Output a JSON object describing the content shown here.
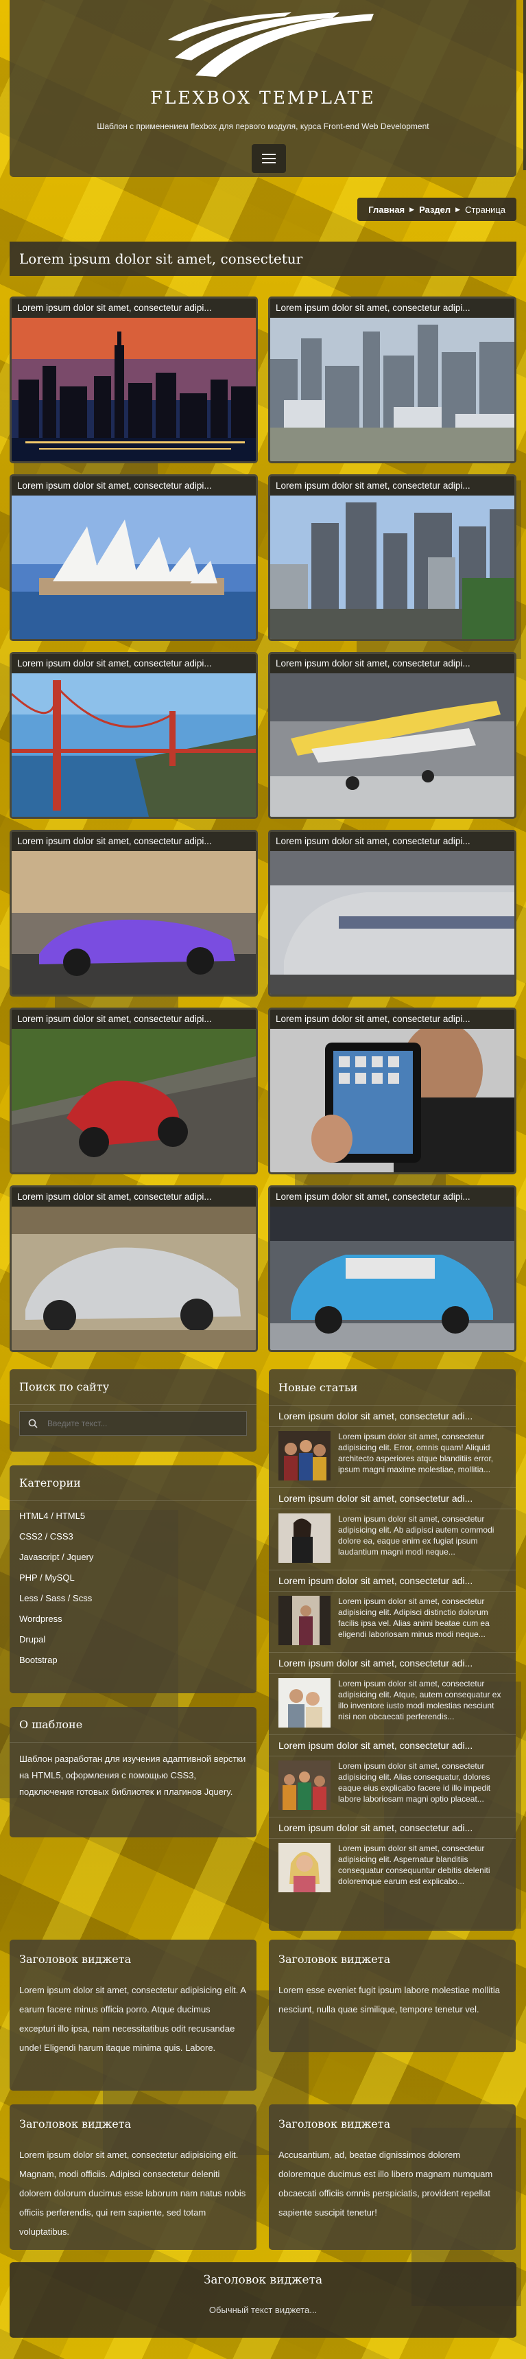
{
  "header": {
    "title": "FLEXBOX TEMPLATE",
    "subtitle": "Шаблон с применением flexbox для первого модуля, курса Front-end Web Development"
  },
  "breadcrumb": {
    "items": [
      "Главная",
      "Раздел"
    ],
    "current": "Страница"
  },
  "page_heading": "Lorem ipsum dolor sit amet, consectetur",
  "gallery": [
    {
      "caption": "Lorem ipsum dolor sit amet, consectetur adipi...",
      "image": "new-york-skyline-night"
    },
    {
      "caption": "Lorem ipsum dolor sit amet, consectetur adipi...",
      "image": "city-skyline-day"
    },
    {
      "caption": "Lorem ipsum dolor sit amet, consectetur adipi...",
      "image": "sydney-opera-house"
    },
    {
      "caption": "Lorem ipsum dolor sit amet, consectetur adipi...",
      "image": "city-highway-towers"
    },
    {
      "caption": "Lorem ipsum dolor sit amet, consectetur adipi...",
      "image": "golden-gate-bridge"
    },
    {
      "caption": "Lorem ipsum dolor sit amet, consectetur adipi...",
      "image": "vintage-airplane-hangar"
    },
    {
      "caption": "Lorem ipsum dolor sit amet, consectetur adipi...",
      "image": "purple-sports-car"
    },
    {
      "caption": "Lorem ipsum dolor sit amet, consectetur adipi...",
      "image": "high-speed-train"
    },
    {
      "caption": "Lorem ipsum dolor sit amet, consectetur adipi...",
      "image": "motorcycle-racer"
    },
    {
      "caption": "Lorem ipsum dolor sit amet, consectetur adipi...",
      "image": "man-holding-tablet"
    },
    {
      "caption": "Lorem ipsum dolor sit amet, consectetur adipi...",
      "image": "silver-sports-car"
    },
    {
      "caption": "Lorem ipsum dolor sit amet, consectetur adipi...",
      "image": "blue-mini-car"
    }
  ],
  "search_widget": {
    "title": "Поиск по сайту",
    "placeholder": "Введите текст..."
  },
  "categories_widget": {
    "title": "Категории",
    "items": [
      "HTML4 / HTML5",
      "CSS2 / CSS3",
      "Javascript / Jquery",
      "PHP / MySQL",
      "Less / Sass / Scss",
      "Wordpress",
      "Drupal",
      "Bootstrap"
    ]
  },
  "about_widget": {
    "title": "О шаблоне",
    "text": "Шаблон разработан для изучения адаптивной верстки на HTML5, оформления с помощью CSS3, подключения готовых библиотек и плагинов Jquery."
  },
  "news_widget": {
    "title": "Новые статьи",
    "articles": [
      {
        "title": "Lorem ipsum dolor sit amet, consectetur adi...",
        "text": "Lorem ipsum dolor sit amet, consectetur adipisicing elit. Error, omnis quam! Aliquid architecto asperiores atque blanditiis error, ipsum magni maxime molestiae, mollitia...",
        "thumb": "group-people"
      },
      {
        "title": "Lorem ipsum dolor sit amet, consectetur adi...",
        "text": "Lorem ipsum dolor sit amet, consectetur adipisicing elit. Ab adipisci autem commodi dolore ea, eaque enim ex fugiat ipsum laudantium magni modi neque...",
        "thumb": "woman-posing"
      },
      {
        "title": "Lorem ipsum dolor sit amet, consectetur adi...",
        "text": "Lorem ipsum dolor sit amet, consectetur adipisicing elit. Adipisci distinctio dolorum facilis ipsa vel. Alias animi beatae cum ea eligendi laboriosam minus modi neque...",
        "thumb": "woman-doorway"
      },
      {
        "title": "Lorem ipsum dolor sit amet, consectetur adi...",
        "text": "Lorem ipsum dolor sit amet, consectetur adipisicing elit. Atque, autem consequatur ex illo inventore iusto modi molestias nesciunt nisi non obcaecati perferendis...",
        "thumb": "couple-bright"
      },
      {
        "title": "Lorem ipsum dolor sit amet, consectetur adi...",
        "text": "Lorem ipsum dolor sit amet, consectetur adipisicing elit. Alias consequatur, dolores eaque eius explicabo facere id illo impedit labore laboriosam magni optio placeat...",
        "thumb": "friends-group"
      },
      {
        "title": "Lorem ipsum dolor sit amet, consectetur adi...",
        "text": "Lorem ipsum dolor sit amet, consectetur adipisicing elit. Aspernatur blanditiis consequatur consequuntur debitis deleniti doloremque earum est explicabo...",
        "thumb": "blonde-woman"
      }
    ]
  },
  "footer_widgets": [
    {
      "title": "Заголовок виджета",
      "text": "Lorem ipsum dolor sit amet, consectetur adipisicing elit. A earum facere minus officia porro. Atque ducimus excepturi illo ipsa, nam necessitatibus odit recusandae unde! Eligendi harum itaque minima quis. Labore."
    },
    {
      "title": "Заголовок виджета",
      "text": "Lorem esse eveniet fugit ipsum labore molestiae mollitia nesciunt, nulla quae similique, tempore tenetur vel."
    },
    {
      "title": "Заголовок виджета",
      "text": "Lorem ipsum dolor sit amet, consectetur adipisicing elit. Magnam, modi officiis. Adipisci consectetur deleniti dolorem dolorum ducimus esse laborum nam natus nobis officiis perferendis, qui rem sapiente, sed totam voluptatibus."
    },
    {
      "title": "Заголовок виджета",
      "text": "Accusantium, ad, beatae dignissimos dolorem doloremque ducimus est illo libero magnam numquam obcaecati officiis omnis perspiciatis, provident repellat sapiente suscipit tenetur!"
    }
  ],
  "footer": {
    "title": "Заголовок виджета",
    "text": "Обычный текст виджета..."
  },
  "colors": {
    "background": "#c9a100",
    "panel": "#413c2d",
    "text": "#ffffff"
  }
}
